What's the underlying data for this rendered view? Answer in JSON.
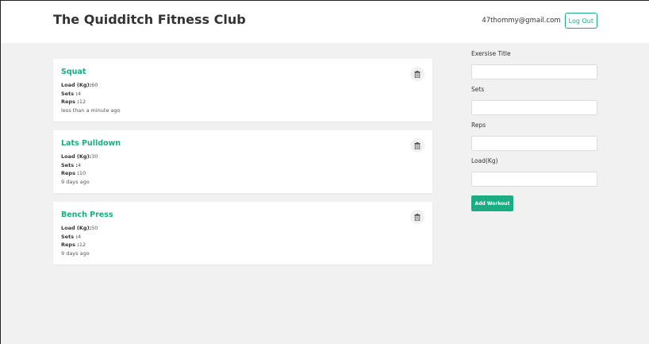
{
  "header": {
    "title": "The Quidditch Fitness Club",
    "user_email": "47thommy@gmail.com",
    "logout_label": "Log Out"
  },
  "workouts": [
    {
      "title": "Squat",
      "load_label": "Load (Kg):",
      "load": "60",
      "sets_label": "Sets :",
      "sets": "4",
      "reps_label": "Reps :",
      "reps": "12",
      "time": "less than a minute ago",
      "delete_icon": "trash-icon"
    },
    {
      "title": "Lats Pulldown",
      "load_label": "Load (Kg):",
      "load": "30",
      "sets_label": "Sets :",
      "sets": "4",
      "reps_label": "Reps :",
      "reps": "10",
      "time": "9 days ago",
      "delete_icon": "trash-icon"
    },
    {
      "title": "Bench Press",
      "load_label": "Load (Kg):",
      "load": "50",
      "sets_label": "Sets :",
      "sets": "4",
      "reps_label": "Reps :",
      "reps": "12",
      "time": "9 days ago",
      "delete_icon": "trash-icon"
    }
  ],
  "form": {
    "title_label": "Exersise Title",
    "title_value": "",
    "sets_label": "Sets",
    "sets_value": "",
    "reps_label": "Reps",
    "reps_value": "",
    "load_label": "Load(Kg)",
    "load_value": "",
    "submit_label": "Add Workout"
  },
  "colors": {
    "accent": "#1aac83",
    "background": "#f1f1f1",
    "card": "#ffffff"
  }
}
